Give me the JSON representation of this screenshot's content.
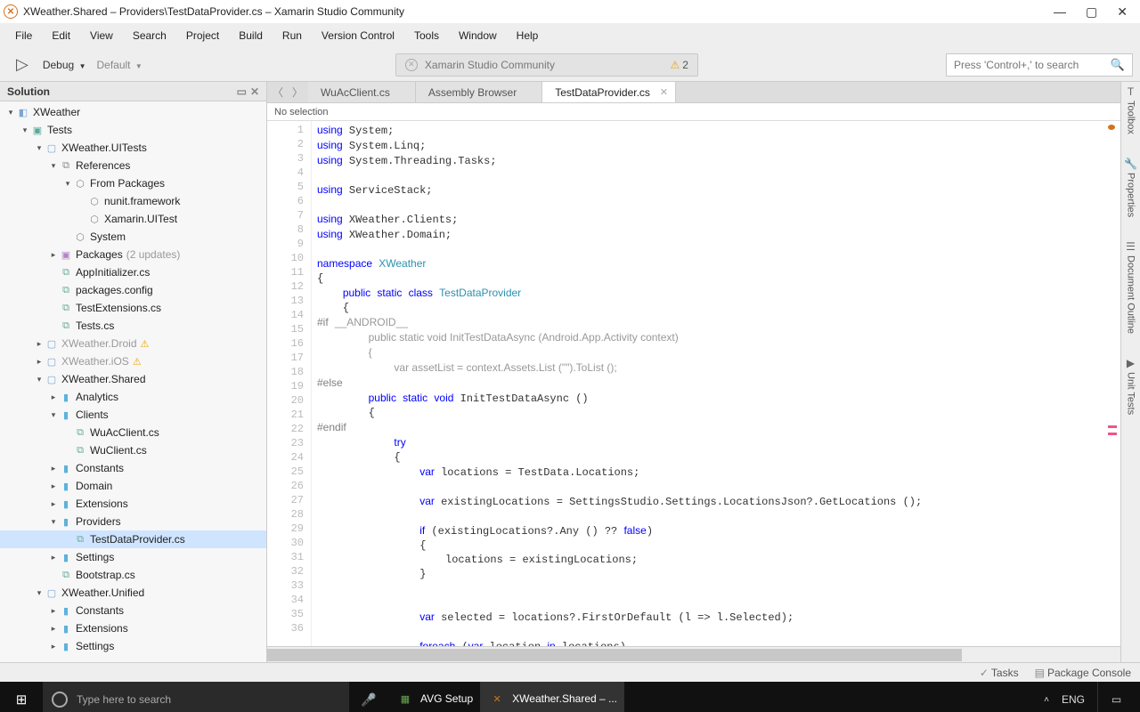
{
  "window": {
    "title": "XWeather.Shared – Providers\\TestDataProvider.cs – Xamarin Studio Community"
  },
  "menu": [
    "File",
    "Edit",
    "View",
    "Search",
    "Project",
    "Build",
    "Run",
    "Version Control",
    "Tools",
    "Window",
    "Help"
  ],
  "toolbar": {
    "config": "Debug",
    "target": "Default",
    "center": "Xamarin Studio Community",
    "warn_count": "2",
    "search_placeholder": "Press 'Control+,' to search"
  },
  "solution": {
    "header": "Solution",
    "tree": [
      {
        "d": 0,
        "tw": "▾",
        "ic": "◧",
        "cls": "ic-prj",
        "lbl": "XWeather"
      },
      {
        "d": 1,
        "tw": "▾",
        "ic": "▣",
        "cls": "ic-sln",
        "lbl": "Tests"
      },
      {
        "d": 2,
        "tw": "▾",
        "ic": "▢",
        "cls": "ic-prj",
        "lbl": "XWeather.UITests"
      },
      {
        "d": 3,
        "tw": "▾",
        "ic": "⧉",
        "cls": "ic-ref",
        "lbl": "References"
      },
      {
        "d": 4,
        "tw": "▾",
        "ic": "⬡",
        "cls": "ic-ref",
        "lbl": "From Packages"
      },
      {
        "d": 5,
        "tw": "",
        "ic": "⬡",
        "cls": "ic-ref",
        "lbl": "nunit.framework"
      },
      {
        "d": 5,
        "tw": "",
        "ic": "⬡",
        "cls": "ic-ref",
        "lbl": "Xamarin.UITest"
      },
      {
        "d": 4,
        "tw": "",
        "ic": "⬡",
        "cls": "ic-ref",
        "lbl": "System"
      },
      {
        "d": 3,
        "tw": "▸",
        "ic": "▣",
        "cls": "ic-pkg",
        "lbl": "Packages",
        "suffix": "(2 updates)"
      },
      {
        "d": 3,
        "tw": "",
        "ic": "⧉",
        "cls": "ic-cs",
        "lbl": "AppInitializer.cs"
      },
      {
        "d": 3,
        "tw": "",
        "ic": "⧉",
        "cls": "ic-cs",
        "lbl": "packages.config"
      },
      {
        "d": 3,
        "tw": "",
        "ic": "⧉",
        "cls": "ic-cs",
        "lbl": "TestExtensions.cs"
      },
      {
        "d": 3,
        "tw": "",
        "ic": "⧉",
        "cls": "ic-cs",
        "lbl": "Tests.cs"
      },
      {
        "d": 2,
        "tw": "▸",
        "ic": "▢",
        "cls": "ic-prj",
        "lbl": "XWeather.Droid",
        "gray": true,
        "warn": true
      },
      {
        "d": 2,
        "tw": "▸",
        "ic": "▢",
        "cls": "ic-prj",
        "lbl": "XWeather.iOS",
        "gray": true,
        "warn": true
      },
      {
        "d": 2,
        "tw": "▾",
        "ic": "▢",
        "cls": "ic-prj",
        "lbl": "XWeather.Shared"
      },
      {
        "d": 3,
        "tw": "▸",
        "ic": "▮",
        "cls": "ic-blu",
        "lbl": "Analytics"
      },
      {
        "d": 3,
        "tw": "▾",
        "ic": "▮",
        "cls": "ic-blu",
        "lbl": "Clients"
      },
      {
        "d": 4,
        "tw": "",
        "ic": "⧉",
        "cls": "ic-cs",
        "lbl": "WuAcClient.cs"
      },
      {
        "d": 4,
        "tw": "",
        "ic": "⧉",
        "cls": "ic-cs",
        "lbl": "WuClient.cs"
      },
      {
        "d": 3,
        "tw": "▸",
        "ic": "▮",
        "cls": "ic-blu",
        "lbl": "Constants"
      },
      {
        "d": 3,
        "tw": "▸",
        "ic": "▮",
        "cls": "ic-blu",
        "lbl": "Domain"
      },
      {
        "d": 3,
        "tw": "▸",
        "ic": "▮",
        "cls": "ic-blu",
        "lbl": "Extensions"
      },
      {
        "d": 3,
        "tw": "▾",
        "ic": "▮",
        "cls": "ic-blu",
        "lbl": "Providers"
      },
      {
        "d": 4,
        "tw": "",
        "ic": "⧉",
        "cls": "ic-cs",
        "lbl": "TestDataProvider.cs",
        "sel": true
      },
      {
        "d": 3,
        "tw": "▸",
        "ic": "▮",
        "cls": "ic-blu",
        "lbl": "Settings"
      },
      {
        "d": 3,
        "tw": "",
        "ic": "⧉",
        "cls": "ic-cs",
        "lbl": "Bootstrap.cs"
      },
      {
        "d": 2,
        "tw": "▾",
        "ic": "▢",
        "cls": "ic-prj",
        "lbl": "XWeather.Unified"
      },
      {
        "d": 3,
        "tw": "▸",
        "ic": "▮",
        "cls": "ic-blu",
        "lbl": "Constants"
      },
      {
        "d": 3,
        "tw": "▸",
        "ic": "▮",
        "cls": "ic-blu",
        "lbl": "Extensions"
      },
      {
        "d": 3,
        "tw": "▸",
        "ic": "▮",
        "cls": "ic-blu",
        "lbl": "Settings"
      }
    ]
  },
  "tabs": [
    {
      "label": "WuAcClient.cs",
      "active": false
    },
    {
      "label": "Assembly Browser",
      "active": false
    },
    {
      "label": "TestDataProvider.cs",
      "active": true
    }
  ],
  "breadcrumb": "No selection",
  "code_lines": [
    "<span class='kw'>using</span> System;",
    "<span class='kw'>using</span> System.Linq;",
    "<span class='kw'>using</span> System.Threading.Tasks;",
    "",
    "<span class='kw'>using</span> ServiceStack;",
    "",
    "<span class='kw'>using</span> XWeather.Clients;",
    "<span class='kw'>using</span> XWeather.Domain;",
    "",
    "<span class='kw'>namespace</span> <span class='ty'>XWeather</span>",
    "{",
    "    <span class='kw'>public</span> <span class='kw'>static</span> <span class='kw'>class</span> <span class='ty'>TestDataProvider</span>",
    "    {",
    "<span class='pp'>#if</span> <span class='gy'>__ANDROID__</span>",
    "        <span class='gy'>public static void InitTestDataAsync (Android.App.Activity context)</span>",
    "        <span class='gy'>{</span>",
    "            <span class='gy'>var assetList = context.Assets.List (\"\").ToList ();</span>",
    "<span class='pp'>#else</span>",
    "        <span class='kw'>public</span> <span class='kw'>static</span> <span class='kw'>void</span> InitTestDataAsync ()",
    "        {",
    "<span class='pp'>#endif</span>",
    "            <span class='kw'>try</span>",
    "            {",
    "                <span class='kw'>var</span> locations = TestData.Locations;",
    "",
    "                <span class='kw'>var</span> existingLocations = SettingsStudio.Settings.LocationsJson?.GetLocations ();",
    "",
    "                <span class='kw'>if</span> (existingLocations?.Any () ?? <span class='kw'>false</span>)",
    "                {",
    "                    locations = existingLocations;",
    "                }",
    "",
    "",
    "                <span class='kw'>var</span> selected = locations?.FirstOrDefault (l => l.Selected);",
    "",
    "                <span class='kw'>foreach</span> (<span class='kw'>var</span> location <span class='kw'>in</span> locations)"
  ],
  "right_tabs": [
    "Toolbox",
    "Properties",
    "Document Outline",
    "Unit Tests"
  ],
  "status": {
    "tasks": "Tasks",
    "console": "Package Console"
  },
  "taskbar": {
    "search_placeholder": "Type here to search",
    "items": [
      {
        "icon": "▦",
        "color": "#6aa84f",
        "label": "AVG Setup"
      },
      {
        "icon": "✕",
        "color": "#d1731f",
        "label": "XWeather.Shared – ...",
        "active": true
      }
    ],
    "lang": "ENG"
  }
}
